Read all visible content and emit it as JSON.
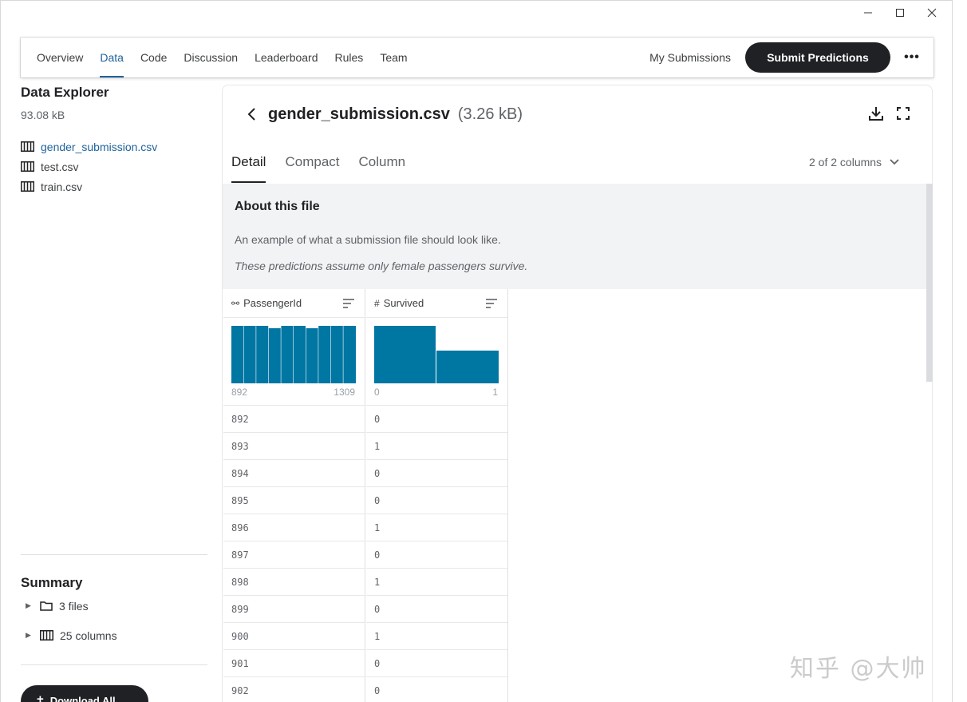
{
  "nav": {
    "tabs": [
      "Overview",
      "Data",
      "Code",
      "Discussion",
      "Leaderboard",
      "Rules",
      "Team"
    ],
    "active_tab": "Data",
    "my_submissions": "My Submissions",
    "submit_label": "Submit Predictions",
    "more_icon": "more-horizontal-icon"
  },
  "sidebar": {
    "title": "Data Explorer",
    "size": "93.08 kB",
    "files": [
      "gender_submission.csv",
      "test.csv",
      "train.csv"
    ],
    "active_file": "gender_submission.csv",
    "summary_title": "Summary",
    "summary_files": "3 files",
    "summary_columns": "25 columns",
    "download_label": "Download All"
  },
  "file": {
    "name": "gender_submission.csv",
    "size": "(3.26 kB)",
    "view_tabs": [
      "Detail",
      "Compact",
      "Column"
    ],
    "active_view": "Detail",
    "column_count": "2 of 2 columns"
  },
  "about": {
    "title": "About this file",
    "description": "An example of what a submission file should look like.",
    "note": "These predictions assume only female passengers survive."
  },
  "table": {
    "columns": [
      {
        "name": "PassengerId",
        "type_icon": "key-icon",
        "hist_min": "892",
        "hist_max": "1309"
      },
      {
        "name": "Survived",
        "type_icon": "hash-icon",
        "hist_min": "0",
        "hist_max": "1"
      }
    ],
    "rows": [
      [
        "892",
        "0"
      ],
      [
        "893",
        "1"
      ],
      [
        "894",
        "0"
      ],
      [
        "895",
        "0"
      ],
      [
        "896",
        "1"
      ],
      [
        "897",
        "0"
      ],
      [
        "898",
        "1"
      ],
      [
        "899",
        "0"
      ],
      [
        "900",
        "1"
      ],
      [
        "901",
        "0"
      ],
      [
        "902",
        "0"
      ]
    ]
  },
  "colors": {
    "accent": "#20639b",
    "bar": "#0076a3",
    "dark": "#202124"
  },
  "watermark": "知乎 @大帅"
}
